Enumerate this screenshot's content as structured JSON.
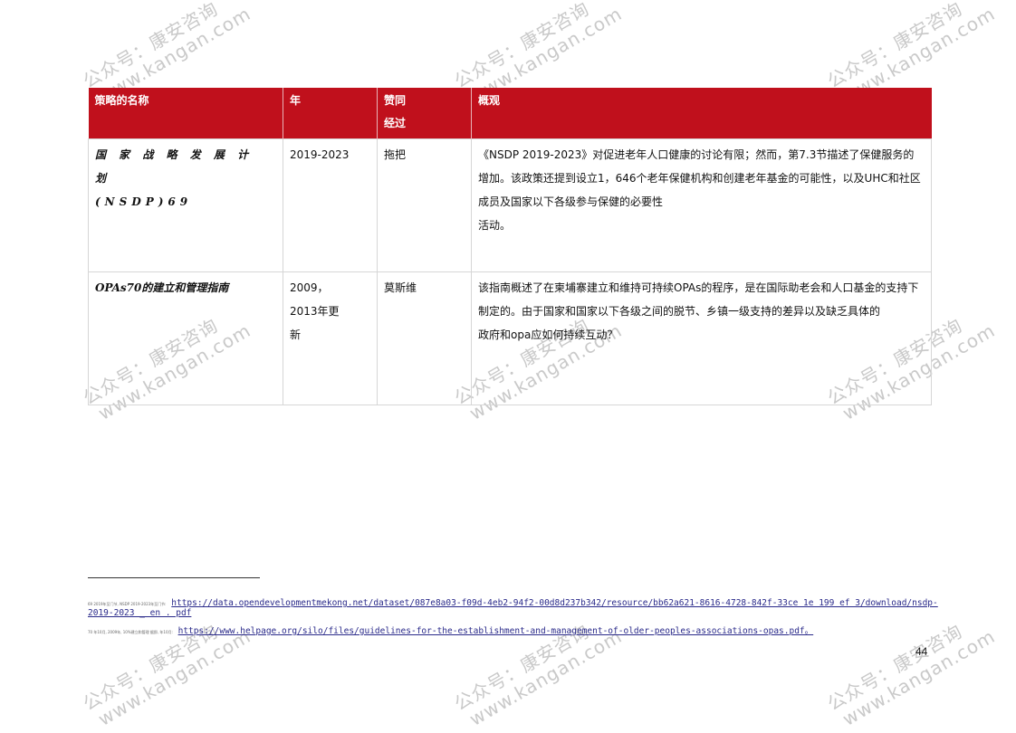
{
  "watermark": {
    "line1": "公众号：康安咨询",
    "line2": "www.kangan.com"
  },
  "table": {
    "headers": [
      "策略的名称",
      "年",
      "赞同\n经过",
      "概观"
    ],
    "rows": [
      {
        "name": "国 家 战 略 发 展 计 划\n(NSDP)69",
        "year": "2019-2023",
        "approver": "拖把",
        "overview": "《NSDP 2019-2023》对促进老年人口健康的讨论有限；然而，第7.3节描述了保健服务的增加。该政策还提到设立1，646个老年保健机构和创建老年基金的可能性，以及UHC和社区成员及国家以下各级参与保健的必要性\n活动。"
      },
      {
        "name": "OPAs70的建立和管理指南",
        "year": "2009，\n2013年更\n新",
        "approver": "莫斯维",
        "overview": "该指南概述了在柬埔寨建立和维持可持续OPAs的程序，是在国际助老会和人口基金的支持下制定的。由于国家和国家以下各级之间的脱节、乡镇一级支持的差异以及缺乏具体的\n政府和opa应如何持续互动？"
      }
    ]
  },
  "footnotes": [
    {
      "marker": "69 2019年至门节, NSDP 2019-2023年至门节:",
      "url": "https://data.opendevelopmentmekong.net/dataset/087e8a03-f09d-4eb2-94f2-00d8d237b342/resource/bb62a621-8616-4728-842f-33ce 1e 199 ef 3/download/nsdp-",
      "url_cont": "2019-2023 _ en . pdf"
    },
    {
      "marker": "70 年10月, 2009年, 10%建立和管理 据即, 年10月:",
      "url": "https://www.helpage.org/silo/files/guidelines-for-the-establishment-and-management-of-older-peoples-associations-opas.pdf。"
    }
  ],
  "page_number": "44"
}
